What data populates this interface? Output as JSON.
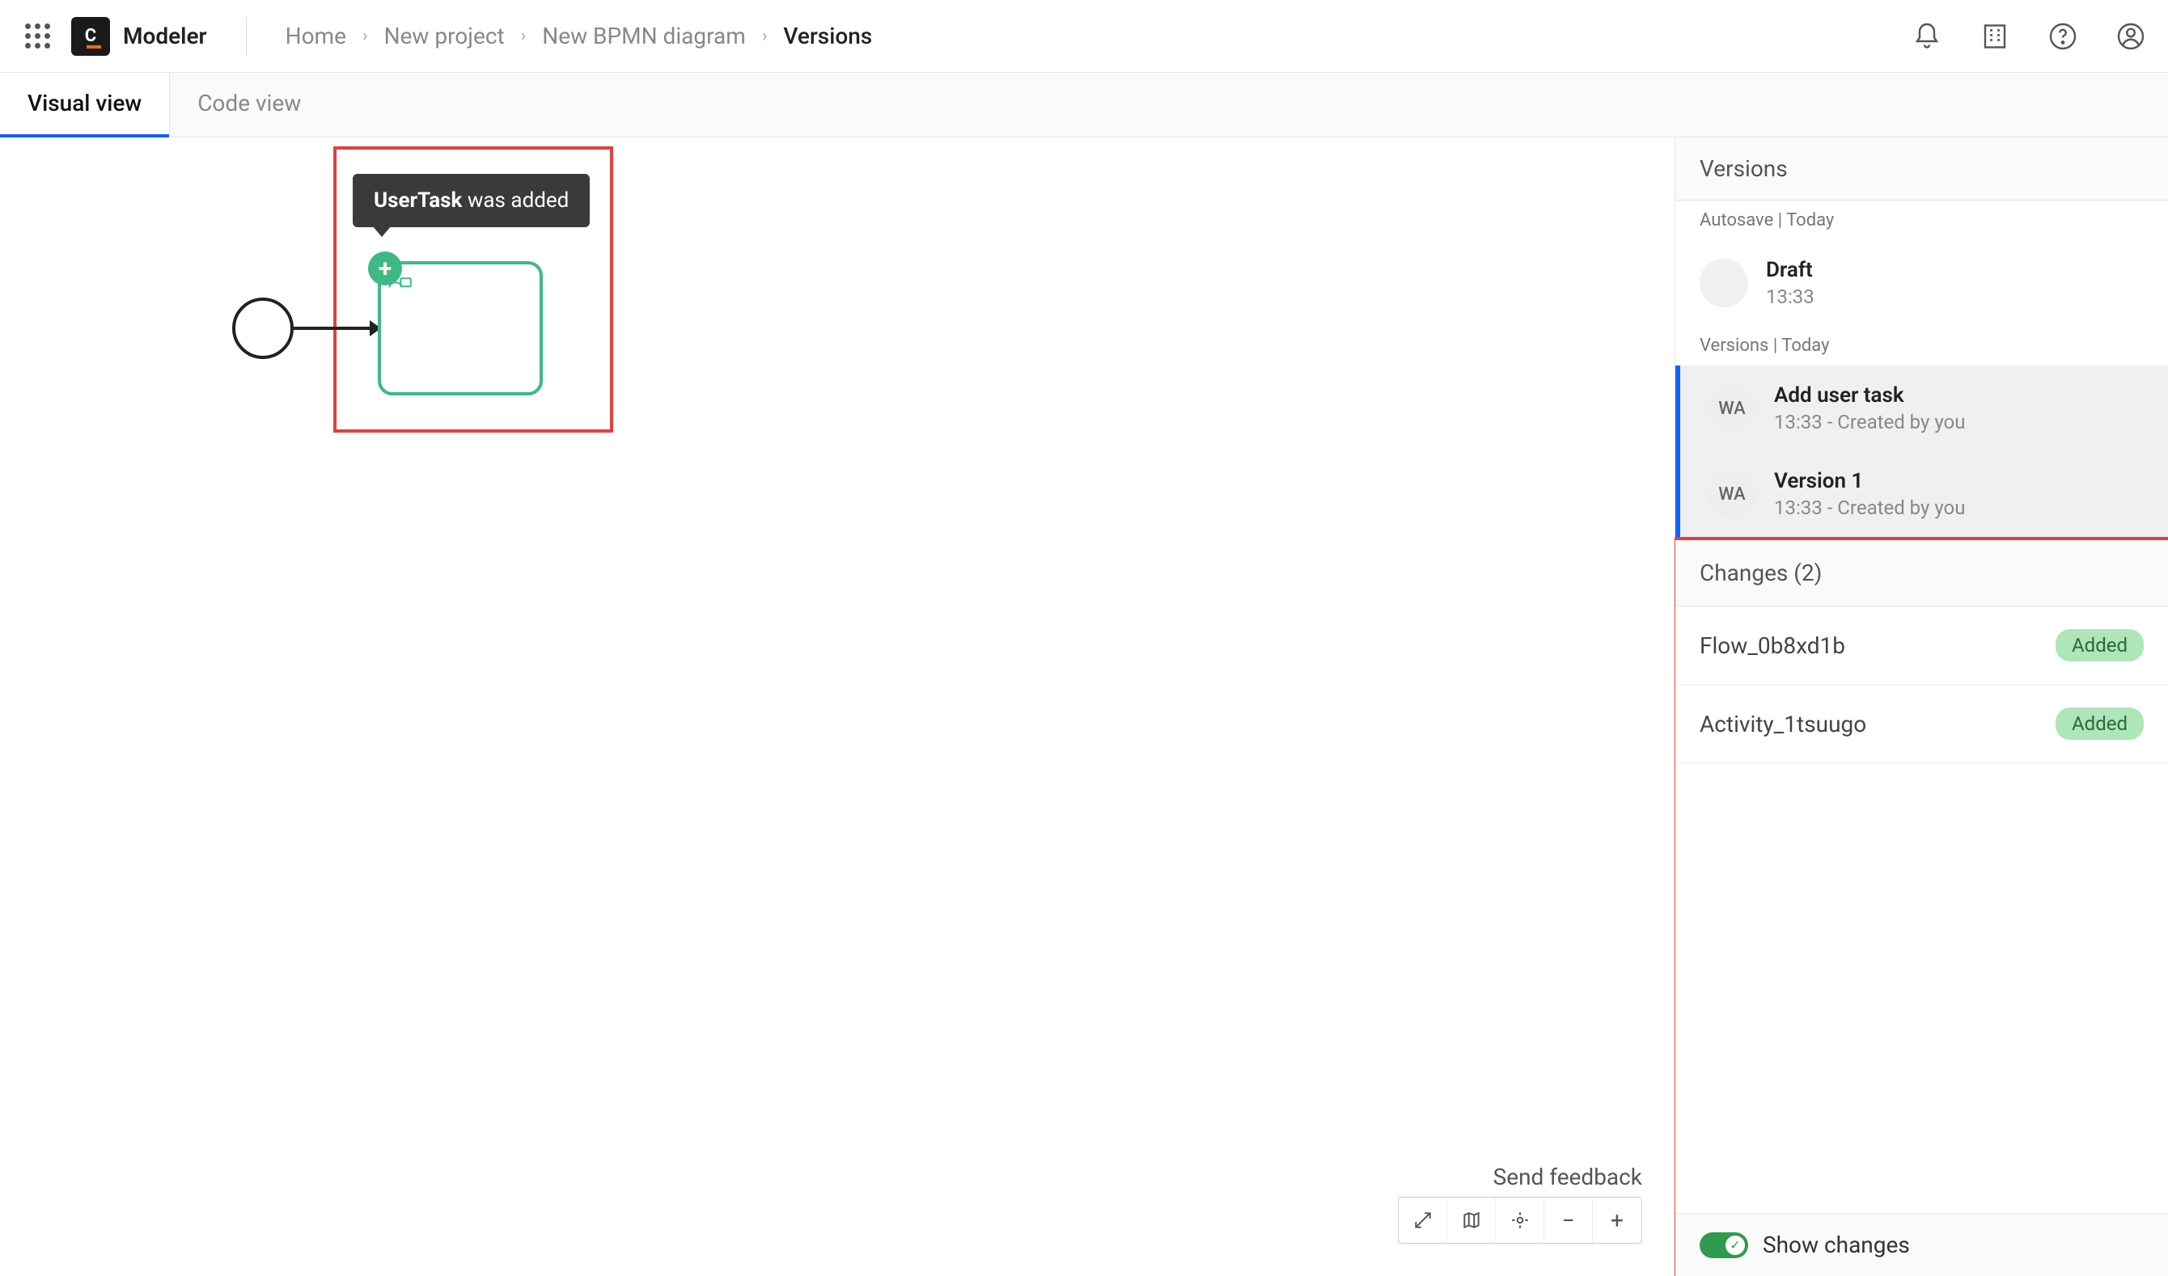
{
  "header": {
    "app_title": "Modeler",
    "breadcrumbs": [
      "Home",
      "New project",
      "New BPMN diagram",
      "Versions"
    ]
  },
  "tabs": {
    "visual": "Visual view",
    "code": "Code view"
  },
  "canvas": {
    "tooltip_strong": "UserTask",
    "tooltip_rest": " was added"
  },
  "footer": {
    "feedback": "Send feedback"
  },
  "versions_panel": {
    "title": "Versions",
    "autosave_header": "Autosave | Today",
    "versions_header": "Versions | Today",
    "draft": {
      "title": "Draft",
      "time": "13:33"
    },
    "items": [
      {
        "avatar": "WA",
        "title": "Add user task",
        "meta": "13:33 - Created by you"
      },
      {
        "avatar": "WA",
        "title": "Version 1",
        "meta": "13:33 - Created by you"
      }
    ]
  },
  "changes": {
    "header": "Changes (2)",
    "rows": [
      {
        "name": "Flow_0b8xd1b",
        "badge": "Added"
      },
      {
        "name": "Activity_1tsuugo",
        "badge": "Added"
      }
    ],
    "toggle_label": "Show changes"
  }
}
